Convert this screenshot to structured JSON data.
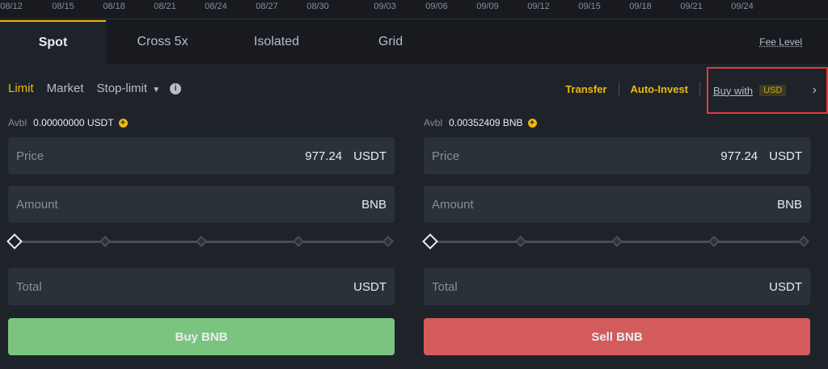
{
  "date_axis": [
    "08/12",
    "08/15",
    "08/18",
    "08/21",
    "08/24",
    "08/27",
    "08/30",
    "09/03",
    "09/06",
    "09/09",
    "09/12",
    "09/15",
    "09/18",
    "09/21",
    "09/24"
  ],
  "tabs": [
    {
      "label": "Spot",
      "active": true
    },
    {
      "label": "Cross 5x",
      "active": false
    },
    {
      "label": "Isolated",
      "active": false
    },
    {
      "label": "Grid",
      "active": false
    }
  ],
  "fee_level": "Fee Level",
  "order_types": {
    "limit": "Limit",
    "market": "Market",
    "stop_limit": "Stop-limit"
  },
  "actions": {
    "transfer": "Transfer",
    "auto_invest": "Auto-Invest",
    "buy_with": "Buy with",
    "buy_with_currency": "USD"
  },
  "buy": {
    "avbl_label": "Avbl",
    "avbl_value": "0.00000000 USDT",
    "price_label": "Price",
    "price_value": "977.24",
    "price_unit": "USDT",
    "amount_label": "Amount",
    "amount_unit": "BNB",
    "total_label": "Total",
    "total_unit": "USDT",
    "button": "Buy BNB",
    "slider_level": 0
  },
  "sell": {
    "avbl_label": "Avbl",
    "avbl_value": "0.00352409 BNB",
    "price_label": "Price",
    "price_value": "977.24",
    "price_unit": "USDT",
    "amount_label": "Amount",
    "amount_unit": "BNB",
    "total_label": "Total",
    "total_unit": "USDT",
    "button": "Sell BNB",
    "slider_level": 0
  },
  "icons": {
    "info": "info-icon",
    "plus": "plus-circle-icon",
    "caret": "caret-down-icon",
    "chevron": "chevron-right-icon"
  },
  "colors": {
    "accent": "#f0b90b",
    "buy": "#7bc47f",
    "sell": "#d35b5b",
    "highlight_box": "#e03a3a"
  }
}
